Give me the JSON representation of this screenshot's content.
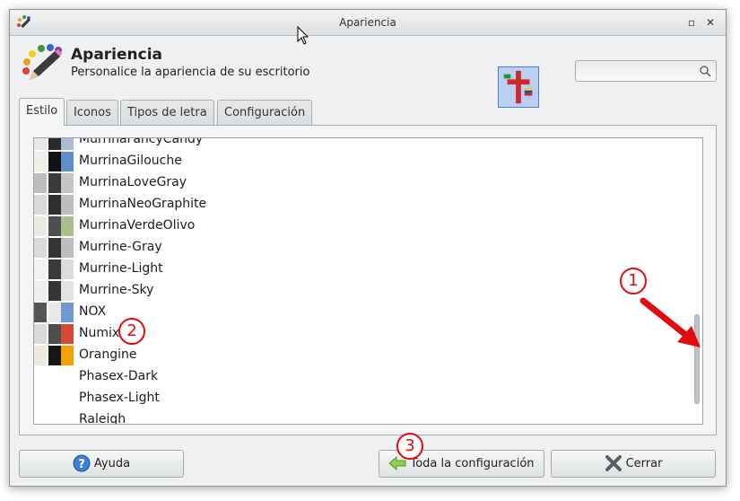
{
  "window": {
    "title": "Apariencia"
  },
  "header": {
    "title": "Apariencia",
    "subtitle": "Personalice la apariencia de su escritorio"
  },
  "search": {
    "placeholder": ""
  },
  "tabs": [
    {
      "label": "Estilo",
      "active": true
    },
    {
      "label": "Iconos",
      "active": false
    },
    {
      "label": "Tipos de letra",
      "active": false
    },
    {
      "label": "Configuración",
      "active": false
    }
  ],
  "themes": [
    {
      "name": "MurrinaFancyCandy",
      "colors": [
        "#e8e8e8",
        "#2a2a2a",
        "#a9bcd3"
      ]
    },
    {
      "name": "MurrinaGilouche",
      "colors": [
        "#f2efe6",
        "#121212",
        "#5d8fcb"
      ]
    },
    {
      "name": "MurrinaLoveGray",
      "colors": [
        "#bdbdbd",
        "#3b3b3b",
        "#c4c4c4"
      ]
    },
    {
      "name": "MurrinaNeoGraphite",
      "colors": [
        "#d9d9d9",
        "#2f2f2f",
        "#bdbdbd"
      ]
    },
    {
      "name": "MurrinaVerdeOlivo",
      "colors": [
        "#ecebe1",
        "#4f4f4f",
        "#a8c08a"
      ]
    },
    {
      "name": "Murrine-Gray",
      "colors": [
        "#dadada",
        "#353535",
        "#bdbdbd"
      ]
    },
    {
      "name": "Murrine-Light",
      "colors": [
        "#f2f2f2",
        "#3a3a3a",
        "#dcdcdc"
      ]
    },
    {
      "name": "Murrine-Sky",
      "colors": [
        "#efefef",
        "#353535",
        "#e3e3e3"
      ]
    },
    {
      "name": "NOX",
      "colors": [
        "#555555",
        "#e9e9e9",
        "#6f9bd0"
      ]
    },
    {
      "name": "Numix",
      "colors": [
        "#d9d9d9",
        "#4d4d4d",
        "#d64937"
      ]
    },
    {
      "name": "Orangine",
      "colors": [
        "#efe9df",
        "#161616",
        "#f4a100"
      ]
    },
    {
      "name": "Phasex-Dark",
      "colors": []
    },
    {
      "name": "Phasex-Light",
      "colors": []
    },
    {
      "name": "Raleigh",
      "colors": []
    }
  ],
  "buttons": {
    "help": "Ayuda",
    "all_settings": "Toda la configuración",
    "close": "Cerrar"
  },
  "annotations": [
    "1",
    "2",
    "3"
  ],
  "colors": {
    "accent": "#e20a0a",
    "selection": "#5d8fcb"
  }
}
